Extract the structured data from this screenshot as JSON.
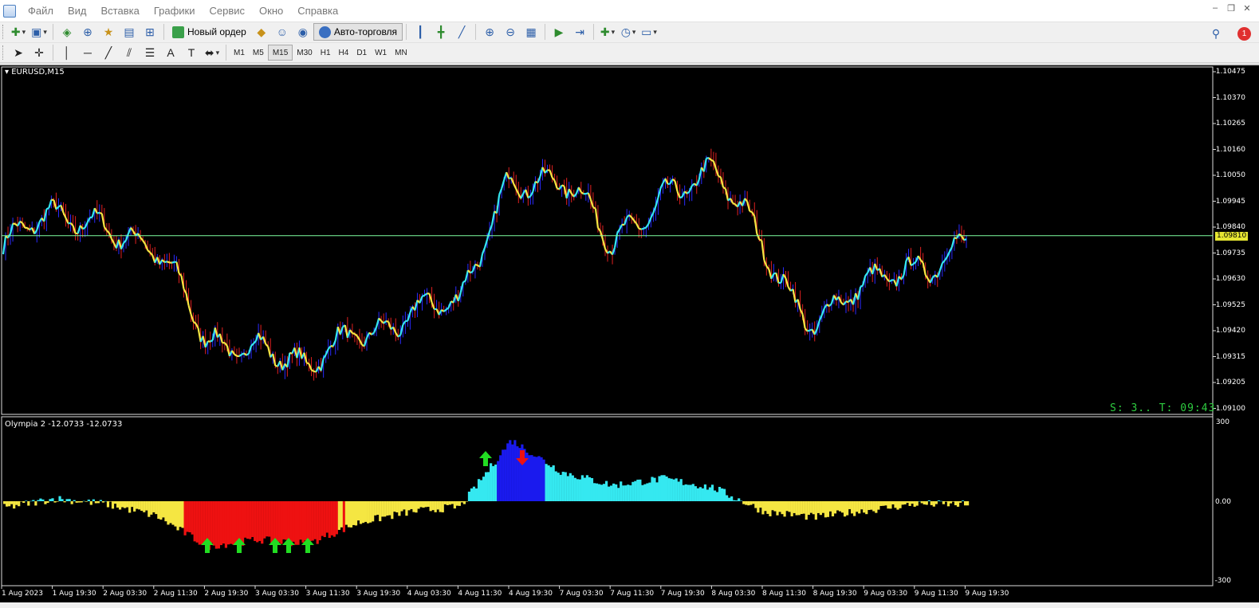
{
  "menu": [
    "Файл",
    "Вид",
    "Вставка",
    "Графики",
    "Сервис",
    "Окно",
    "Справка"
  ],
  "toolbar": {
    "new_order_label": "Новый ордер",
    "autotrade_label": "Авто-торговля",
    "notification_count": "1"
  },
  "timeframes": [
    "M1",
    "M5",
    "M15",
    "M30",
    "H1",
    "H4",
    "D1",
    "W1",
    "MN"
  ],
  "active_timeframe": "M15",
  "chart": {
    "symbol_label": "EURUSD,M15",
    "current_price": "1.09810",
    "price_labels": [
      "1.10475",
      "1.10370",
      "1.10265",
      "1.10160",
      "1.10050",
      "1.09945",
      "1.09840",
      "1.09735",
      "1.09630",
      "1.09525",
      "1.09420",
      "1.09315",
      "1.09205",
      "1.09100"
    ],
    "info_text": "S: 3.. T: 09:43",
    "colors": {
      "up_candle": "#35e8f0",
      "down_candle": "#f5e642",
      "wick_up": "#2a2aff",
      "wick_down": "#e02020",
      "level_line": "#7fff9f"
    }
  },
  "indicator": {
    "label": "Olympia 2 -12.0733 -12.0733",
    "scale_labels": [
      "300",
      "0.00",
      "-300"
    ],
    "colors": {
      "positive": "#35e8f0",
      "negative": "#f5e642",
      "strong_pos": "#1a1aee",
      "strong_neg": "#ee1111",
      "buy_arrow": "#22dd22",
      "sell_arrow": "#ee1111"
    }
  },
  "time_labels": [
    "1 Aug 2023",
    "1 Aug 19:30",
    "2 Aug 03:30",
    "2 Aug 11:30",
    "2 Aug 19:30",
    "3 Aug 03:30",
    "3 Aug 11:30",
    "3 Aug 19:30",
    "4 Aug 03:30",
    "4 Aug 11:30",
    "4 Aug 19:30",
    "7 Aug 03:30",
    "7 Aug 11:30",
    "7 Aug 19:30",
    "8 Aug 03:30",
    "8 Aug 11:30",
    "8 Aug 19:30",
    "9 Aug 03:30",
    "9 Aug 11:30",
    "9 Aug 19:30"
  ],
  "chart_data": {
    "type": "line",
    "x": [
      "1 Aug 2023",
      "1 Aug 19:30",
      "2 Aug 03:30",
      "2 Aug 11:30",
      "2 Aug 19:30",
      "3 Aug 03:30",
      "3 Aug 11:30",
      "3 Aug 19:30",
      "4 Aug 03:30",
      "4 Aug 11:30",
      "4 Aug 19:30",
      "7 Aug 03:30",
      "7 Aug 11:30",
      "7 Aug 19:30",
      "8 Aug 03:30",
      "8 Aug 11:30",
      "8 Aug 19:30",
      "9 Aug 03:30",
      "9 Aug 11:30",
      "9 Aug 19:30"
    ],
    "series": [
      {
        "name": "EURUSD,M15",
        "values": [
          1.0976,
          1.0985,
          1.0992,
          1.0972,
          1.0938,
          1.0942,
          1.0921,
          1.0945,
          1.0951,
          1.0948,
          1.101,
          1.1002,
          1.0975,
          1.1003,
          1.1002,
          1.0978,
          1.0948,
          1.0955,
          1.0972,
          1.098
        ]
      },
      {
        "name": "Olympia 2",
        "values": [
          -25,
          10,
          -10,
          -55,
          -170,
          -145,
          -160,
          -80,
          -40,
          -20,
          230,
          110,
          60,
          85,
          50,
          -40,
          -60,
          -35,
          -10,
          -12.0733
        ]
      }
    ],
    "ylim": [
      1.091,
      1.1048
    ]
  }
}
